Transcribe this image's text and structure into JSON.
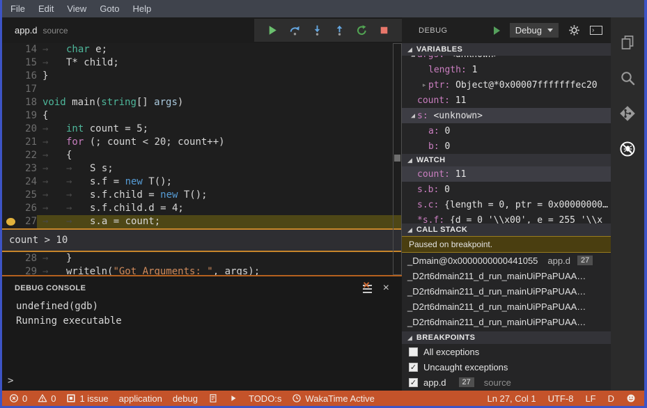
{
  "colors": {
    "accent_border": "#3d54c6",
    "status_bar": "#c4532a",
    "breakpoint": "#e2b23c",
    "current_line_bg": "#4e4716",
    "peek_border": "#c8862b",
    "paused_banner_bg": "#4a3e10"
  },
  "menubar": {
    "items": [
      "File",
      "Edit",
      "View",
      "Goto",
      "Help"
    ]
  },
  "editor": {
    "tab": {
      "name": "app.d",
      "hint": "source"
    },
    "toolbar": {
      "buttons": [
        {
          "name": "continue-button",
          "icon": "play",
          "color": "#6abf6e"
        },
        {
          "name": "step-over-button",
          "icon": "step-over",
          "color": "#64a6e0"
        },
        {
          "name": "step-into-button",
          "icon": "step-into",
          "color": "#64a6e0"
        },
        {
          "name": "step-out-button",
          "icon": "step-out",
          "color": "#64a6e0"
        },
        {
          "name": "restart-button",
          "icon": "restart",
          "color": "#52a553"
        },
        {
          "name": "stop-button",
          "icon": "stop",
          "color": "#e8776b"
        }
      ]
    },
    "breakpoint_line": 27,
    "condition_peek": "count > 10",
    "lines": [
      {
        "n": 14,
        "segs": [
          [
            "tab",
            "→"
          ],
          [
            "type",
            "char"
          ],
          [
            "pl",
            " e;"
          ]
        ]
      },
      {
        "n": 15,
        "segs": [
          [
            "tab",
            "→"
          ],
          [
            "pl",
            "T* child;"
          ]
        ]
      },
      {
        "n": 16,
        "segs": [
          [
            "pl",
            "}"
          ]
        ]
      },
      {
        "n": 17,
        "segs": []
      },
      {
        "n": 18,
        "segs": [
          [
            "type",
            "void"
          ],
          [
            "pl",
            " main("
          ],
          [
            "type",
            "string"
          ],
          [
            "pl",
            "[] "
          ],
          [
            "param",
            "args"
          ],
          [
            "pl",
            ")"
          ]
        ]
      },
      {
        "n": 19,
        "segs": [
          [
            "pl",
            "{"
          ]
        ]
      },
      {
        "n": 20,
        "segs": [
          [
            "tab",
            "→"
          ],
          [
            "type",
            "int"
          ],
          [
            "pl",
            " count = 5;"
          ]
        ]
      },
      {
        "n": 21,
        "segs": [
          [
            "tab",
            "→"
          ],
          [
            "flow",
            "for"
          ],
          [
            "pl",
            " (; count < 20; count++)"
          ]
        ]
      },
      {
        "n": 22,
        "segs": [
          [
            "tab",
            "→"
          ],
          [
            "pl",
            "{"
          ]
        ]
      },
      {
        "n": 23,
        "segs": [
          [
            "tab",
            "→"
          ],
          [
            "tab",
            "→"
          ],
          [
            "pl",
            "S s;"
          ]
        ]
      },
      {
        "n": 24,
        "segs": [
          [
            "tab",
            "→"
          ],
          [
            "tab",
            "→"
          ],
          [
            "pl",
            "s.f = "
          ],
          [
            "new",
            "new"
          ],
          [
            "pl",
            " T();"
          ]
        ]
      },
      {
        "n": 25,
        "segs": [
          [
            "tab",
            "→"
          ],
          [
            "tab",
            "→"
          ],
          [
            "pl",
            "s.f.child = "
          ],
          [
            "new",
            "new"
          ],
          [
            "pl",
            " T();"
          ]
        ]
      },
      {
        "n": 26,
        "segs": [
          [
            "tab",
            "→"
          ],
          [
            "tab",
            "→"
          ],
          [
            "pl",
            "s.f.child.d = 4;"
          ]
        ]
      },
      {
        "n": 27,
        "hl": true,
        "bp": true,
        "segs": [
          [
            "tab",
            "→"
          ],
          [
            "tab",
            "→"
          ],
          [
            "pl",
            "s.a = count;"
          ]
        ]
      },
      {
        "n": 28,
        "segs": [
          [
            "tab",
            "→"
          ],
          [
            "pl",
            "}"
          ]
        ]
      },
      {
        "n": 29,
        "segs": [
          [
            "tab",
            "→"
          ],
          [
            "pl",
            "writeln("
          ],
          [
            "str",
            "\"Got Arguments: \""
          ],
          [
            "pl",
            ", args);"
          ]
        ]
      }
    ]
  },
  "console": {
    "title": "DEBUG CONSOLE",
    "output": [
      "undefined(gdb)",
      "Running executable"
    ],
    "prompt": ">"
  },
  "panel": {
    "title": "DEBUG",
    "config": "Debug",
    "variables": {
      "title": "VARIABLES",
      "rows": [
        {
          "exp": "open",
          "label": "args",
          "value": "<unknown>",
          "depth": 0,
          "clipped": true
        },
        {
          "label": "length",
          "value": "1",
          "depth": 1
        },
        {
          "exp": "closed",
          "label": "ptr",
          "value": "Object@*0x00007fffffffec20",
          "depth": 1
        },
        {
          "label": "count",
          "value": "11",
          "depth": 0
        },
        {
          "exp": "open",
          "label": "s",
          "value": "<unknown>",
          "depth": 0,
          "selected": true
        },
        {
          "label": "a",
          "value": "0",
          "depth": 1
        },
        {
          "label": "b",
          "value": "0",
          "depth": 1
        }
      ]
    },
    "watch": {
      "title": "WATCH",
      "rows": [
        {
          "label": "count",
          "value": "11",
          "depth": 0,
          "selected": true
        },
        {
          "label": "s.b",
          "value": "0",
          "depth": 0
        },
        {
          "label": "s.c",
          "value": "{length = 0, ptr = 0x00000000…",
          "depth": 0
        },
        {
          "label": "*s.f",
          "value": "{d = 0 '\\\\x00', e = 255 '\\\\x",
          "depth": 0
        }
      ]
    },
    "call_stack": {
      "title": "CALL STACK",
      "status": "Paused on breakpoint.",
      "frames": [
        {
          "name": "_Dmain@0x0000000000441055",
          "file": "app.d",
          "line": "27"
        },
        {
          "name": "_D2rt6dmain211_d_run_mainUiPPaPUAA…"
        },
        {
          "name": "_D2rt6dmain211_d_run_mainUiPPaPUAA…"
        },
        {
          "name": "_D2rt6dmain211_d_run_mainUiPPaPUAA…"
        },
        {
          "name": "_D2rt6dmain211_d_run_mainUiPPaPUAA…"
        }
      ]
    },
    "breakpoints": {
      "title": "BREAKPOINTS",
      "items": [
        {
          "checked": false,
          "label": "All exceptions"
        },
        {
          "checked": true,
          "label": "Uncaught exceptions"
        },
        {
          "checked": true,
          "label": "app.d",
          "badge": "27",
          "hint": "source"
        }
      ]
    }
  },
  "status_bar": {
    "left": [
      {
        "name": "errors",
        "icon": "error",
        "label": "0"
      },
      {
        "name": "warnings",
        "icon": "warning",
        "label": "0"
      },
      {
        "name": "issues",
        "icon": "issues",
        "label": "1 issue"
      },
      {
        "name": "project-application",
        "label": "application"
      },
      {
        "name": "config-debug",
        "label": "debug"
      },
      {
        "name": "file-indicator",
        "icon": "file"
      },
      {
        "name": "run",
        "icon": "play-small"
      },
      {
        "name": "todos",
        "label": "TODO:s"
      },
      {
        "name": "wakatime",
        "icon": "clock",
        "label": "WakaTime Active"
      }
    ],
    "right": [
      {
        "name": "cursor-position",
        "label": "Ln 27, Col 1"
      },
      {
        "name": "encoding",
        "label": "UTF-8"
      },
      {
        "name": "eol",
        "label": "LF"
      },
      {
        "name": "language-mode",
        "label": "D"
      },
      {
        "name": "feedback",
        "icon": "smiley"
      }
    ]
  },
  "activity_bar": {
    "items": [
      {
        "name": "explorer",
        "active": false
      },
      {
        "name": "search",
        "active": false
      },
      {
        "name": "source-control",
        "active": false
      },
      {
        "name": "debug",
        "active": true
      }
    ]
  }
}
